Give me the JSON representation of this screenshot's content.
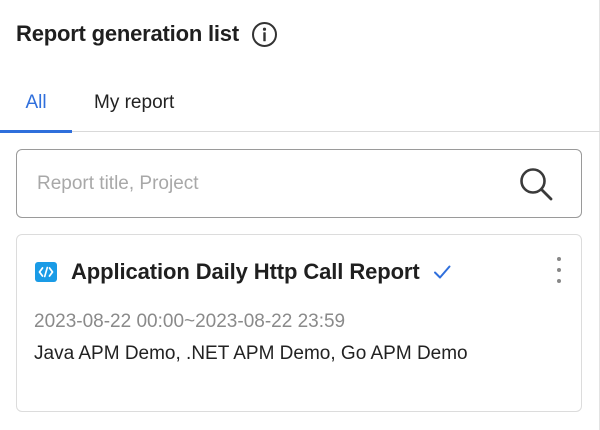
{
  "header": {
    "title": "Report generation list",
    "info_icon": "info-circle-icon"
  },
  "tabs": [
    {
      "label": "All",
      "active": true
    },
    {
      "label": "My report",
      "active": false
    }
  ],
  "search": {
    "value": "",
    "placeholder": "Report title, Project",
    "icon": "search-icon"
  },
  "reports": [
    {
      "icon": "code-icon",
      "title": "Application Daily Http Call Report",
      "checked": true,
      "period": "2023-08-22 00:00~2023-08-22 23:59",
      "projects": "Java APM Demo, .NET APM Demo, Go APM Demo"
    }
  ],
  "colors": {
    "accent": "#2f6fdc",
    "code_icon_bg": "#1a9be6",
    "muted_text": "#8a8a8a",
    "border": "#dcdcdc"
  }
}
